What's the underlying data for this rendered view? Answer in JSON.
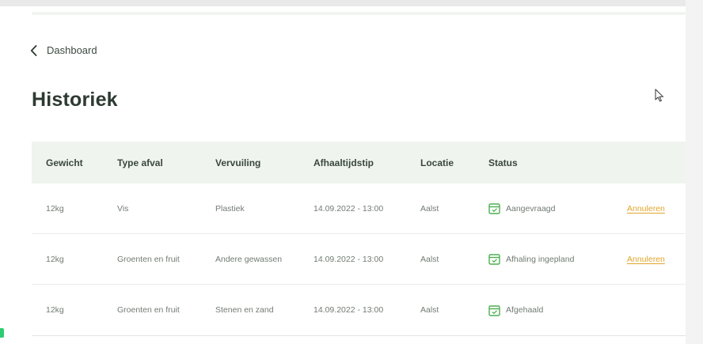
{
  "nav": {
    "back_label": "Dashboard"
  },
  "page": {
    "title": "Historiek"
  },
  "table": {
    "headers": {
      "weight": "Gewicht",
      "type": "Type afval",
      "contamination": "Vervuiling",
      "pickup": "Afhaaltijdstip",
      "location": "Locatie",
      "status": "Status"
    },
    "rows": [
      {
        "weight": "12kg",
        "type": "Vis",
        "contamination": "Plastiek",
        "pickup": "14.09.2022 - 13:00",
        "location": "Aalst",
        "status": "Aangevraagd",
        "action": "Annuleren"
      },
      {
        "weight": "12kg",
        "type": "Groenten en fruit",
        "contamination": "Andere gewassen",
        "pickup": "14.09.2022 - 13:00",
        "location": "Aalst",
        "status": "Afhaling ingepland",
        "action": "Annuleren"
      },
      {
        "weight": "12kg",
        "type": "Groenten en fruit",
        "contamination": "Stenen en zand",
        "pickup": "14.09.2022 - 13:00",
        "location": "Aalst",
        "status": "Afgehaald",
        "action": ""
      }
    ]
  },
  "colors": {
    "accent_green": "#4caf50",
    "header_bg": "#eff4ef",
    "cancel": "#e0a52b"
  }
}
